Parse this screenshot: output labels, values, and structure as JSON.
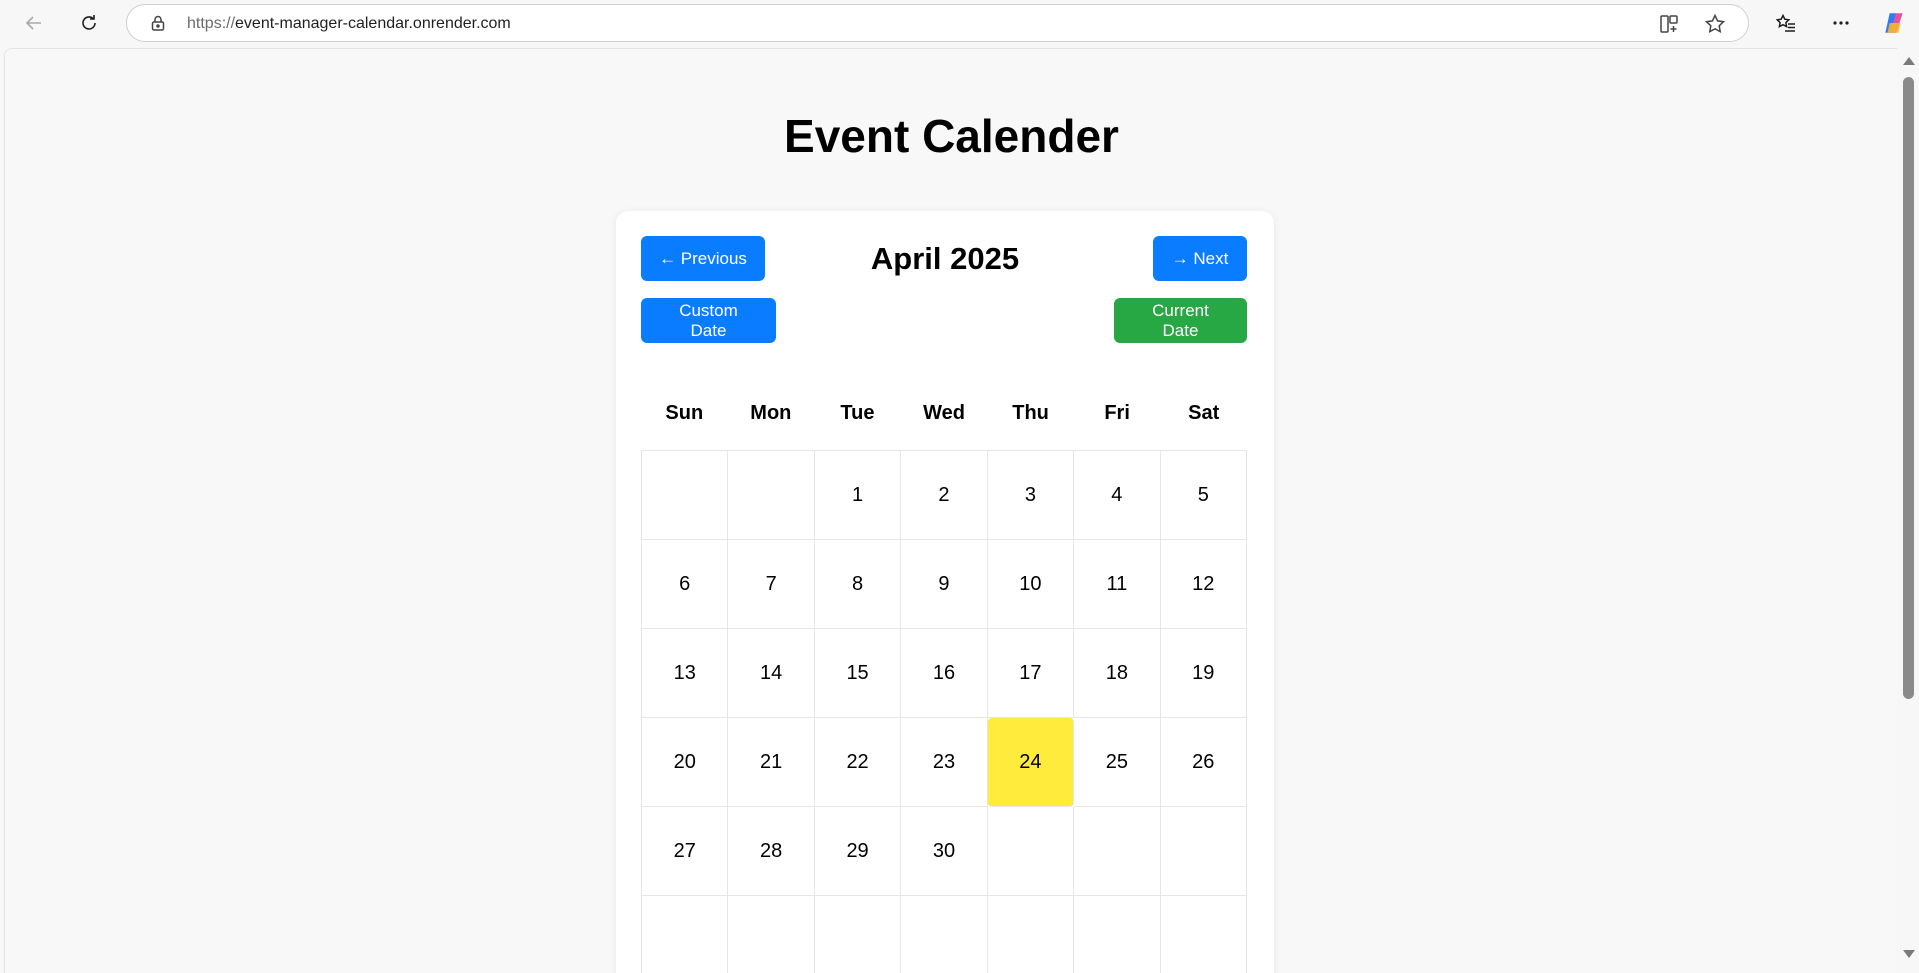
{
  "browser": {
    "url_protocol": "https://",
    "url_host": "event-manager-calendar.onrender.com",
    "icons": {
      "back": "arrow-left-icon",
      "reload": "reload-icon",
      "lock": "lock-icon",
      "split": "split-screen-icon",
      "favorite": "star-icon",
      "favorites": "favorites-list-icon",
      "more": "more-icon",
      "copilot": "copilot-icon"
    }
  },
  "page": {
    "title": "Event Calender"
  },
  "calendar": {
    "month_title": "April 2025",
    "prev_label": "← Previous",
    "next_label": "→ Next",
    "custom_date_label": "Custom Date",
    "current_date_label": "Current Date",
    "weekdays": [
      "Sun",
      "Mon",
      "Tue",
      "Wed",
      "Thu",
      "Fri",
      "Sat"
    ],
    "weeks": [
      [
        "",
        "",
        "1",
        "2",
        "3",
        "4",
        "5"
      ],
      [
        "6",
        "7",
        "8",
        "9",
        "10",
        "11",
        "12"
      ],
      [
        "13",
        "14",
        "15",
        "16",
        "17",
        "18",
        "19"
      ],
      [
        "20",
        "21",
        "22",
        "23",
        "24",
        "25",
        "26"
      ],
      [
        "27",
        "28",
        "29",
        "30",
        "",
        "",
        ""
      ],
      [
        "",
        "",
        "",
        "",
        "",
        "",
        ""
      ]
    ],
    "today": "24",
    "colors": {
      "primary": "#0a7cff",
      "success": "#28a745",
      "today_highlight": "#ffeb3b"
    }
  }
}
